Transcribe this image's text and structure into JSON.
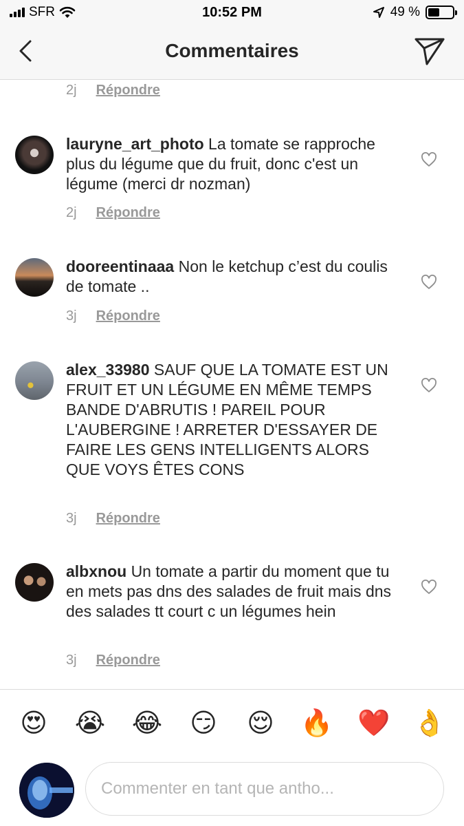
{
  "status_bar": {
    "carrier": "SFR",
    "time": "10:52 PM",
    "battery": "49 %"
  },
  "header": {
    "title": "Commentaires"
  },
  "reply_label": "Répondre",
  "partial_comment": {
    "age": "2j"
  },
  "comments": [
    {
      "username": "lauryne_art_photo",
      "text": "La tomate se rapproche plus du légume que du fruit, donc c'est un légume (merci dr nozman)",
      "age": "2j"
    },
    {
      "username": "dooreentinaaa",
      "text": "Non le ketchup c’est du coulis de tomate ..",
      "age": "3j"
    },
    {
      "username": "alex_33980",
      "text": "SAUF QUE LA TOMATE EST UN FRUIT ET UN LÉGUME EN MÊME TEMPS BANDE D'ABRUTIS ! PAREIL POUR L'AUBERGINE ! ARRETER D'ESSAYER DE FAIRE LES GENS INTELLIGENTS ALORS QUE VOYS ÊTES CONS",
      "age": "3j"
    },
    {
      "username": "albxnou",
      "text": "Un tomate a partir du moment que tu en mets pas dns des salades de fruit mais dns des salades tt court c un légumes hein",
      "age": "3j"
    }
  ],
  "emoji_bar": [
    "😍",
    "😭",
    "😂",
    "😏",
    "😌",
    "🔥",
    "❤️",
    "👌"
  ],
  "input": {
    "placeholder": "Commenter en tant que antho..."
  }
}
